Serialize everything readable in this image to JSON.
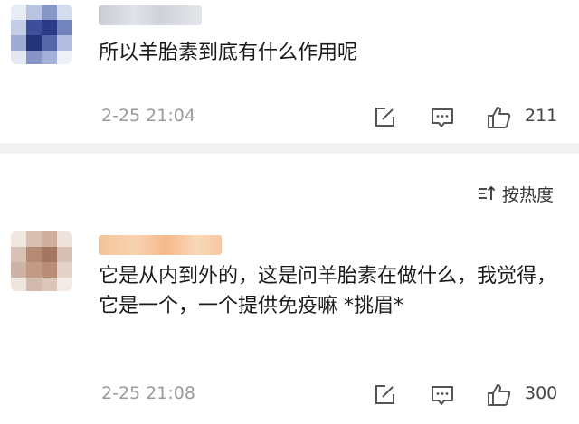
{
  "comments": [
    {
      "text": "所以羊胎素到底有什么作用呢",
      "time": "2-25 21:04",
      "likes": "211"
    },
    {
      "text": "它是从内到外的，这是问羊胎素在做什么，我觉得，它是一个，一个提供免疫嘛 *挑眉*",
      "time": "2-25 21:08",
      "likes": "300"
    }
  ],
  "sort": {
    "label": "按热度",
    "icon": "sort-icon"
  },
  "icons": {
    "edit": "edit-icon",
    "comment": "comment-icon",
    "like": "thumbs-up-icon"
  },
  "colors": {
    "meta_gray": "#9a9a9a",
    "divider": "#f2f2f2",
    "text": "#1a1a1a"
  }
}
